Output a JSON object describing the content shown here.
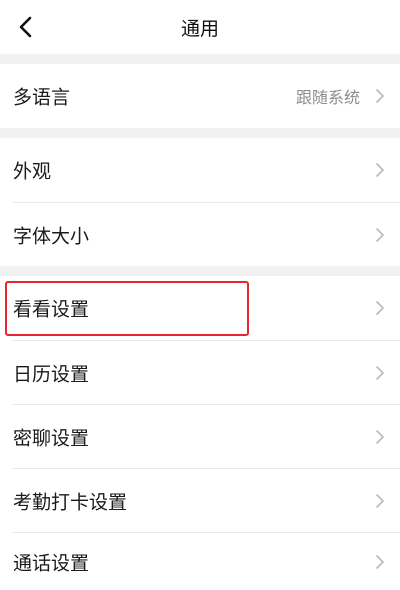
{
  "header": {
    "title": "通用",
    "back_icon": "chevron-left-icon"
  },
  "rows": [
    {
      "label": "多语言",
      "value": "跟随系统"
    },
    {
      "label": "外观",
      "value": ""
    },
    {
      "label": "字体大小",
      "value": ""
    },
    {
      "label": "看看设置",
      "value": ""
    },
    {
      "label": "日历设置",
      "value": ""
    },
    {
      "label": "密聊设置",
      "value": ""
    },
    {
      "label": "考勤打卡设置",
      "value": ""
    },
    {
      "label": "通话设置",
      "value": ""
    }
  ],
  "colors": {
    "section_gap": "#f1f1f4",
    "highlight": "#e8262e",
    "chevron": "#b8b8b8"
  },
  "icons": {
    "row_chevron": "chevron-right-icon"
  }
}
